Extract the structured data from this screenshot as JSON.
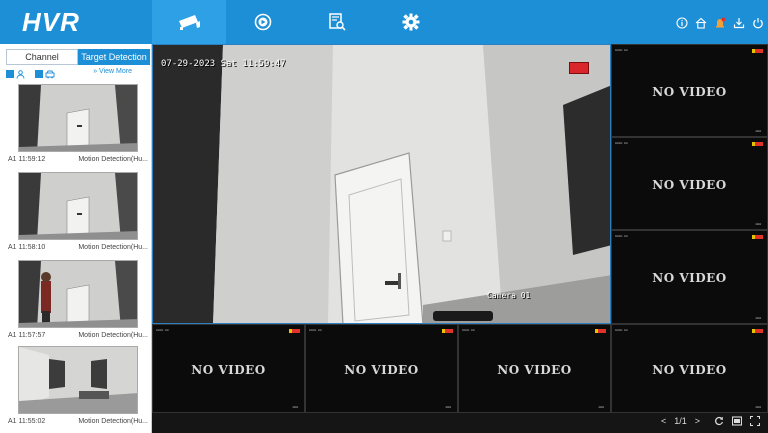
{
  "app": {
    "logo": "HVR"
  },
  "nav": [
    {
      "name": "live-view",
      "icon": "camera-icon",
      "active": true
    },
    {
      "name": "playback",
      "icon": "playback-icon",
      "active": false
    },
    {
      "name": "search",
      "icon": "file-search-icon",
      "active": false
    },
    {
      "name": "settings",
      "icon": "gear-icon",
      "active": false
    }
  ],
  "top_right_icons": [
    "info-icon",
    "home-icon",
    "alarm-icon",
    "download-icon",
    "power-icon"
  ],
  "sidebar": {
    "tabs": [
      {
        "label": "Channel",
        "active": false
      },
      {
        "label": "Target Detection",
        "active": true
      }
    ],
    "filters": [
      {
        "icon": "person-icon",
        "checked": true
      },
      {
        "icon": "vehicle-icon",
        "checked": true
      }
    ],
    "view_more": "» View More",
    "events": [
      {
        "time": "A1 11:59:12",
        "type": "Motion Detection(Hu..."
      },
      {
        "time": "A1 11:58:10",
        "type": "Motion Detection(Hu..."
      },
      {
        "time": "A1 11:57:57",
        "type": "Motion Detection(Hu..."
      },
      {
        "time": "A1 11:55:02",
        "type": "Motion Detection(Hu..."
      }
    ]
  },
  "main_camera": {
    "datetime": "07-29-2023 Sat  11:59:47",
    "name": "Camera 01"
  },
  "tiles": [
    {
      "label": "NO VIDEO"
    },
    {
      "label": "NO VIDEO"
    },
    {
      "label": "NO VIDEO"
    },
    {
      "label": "NO VIDEO"
    },
    {
      "label": "NO VIDEO"
    },
    {
      "label": "NO VIDEO"
    },
    {
      "label": "NO VIDEO"
    }
  ],
  "pager": {
    "prev": "<",
    "page": "1/1",
    "next": ">"
  },
  "colors": {
    "accent": "#1d8fd6",
    "record": "#e0312b"
  }
}
